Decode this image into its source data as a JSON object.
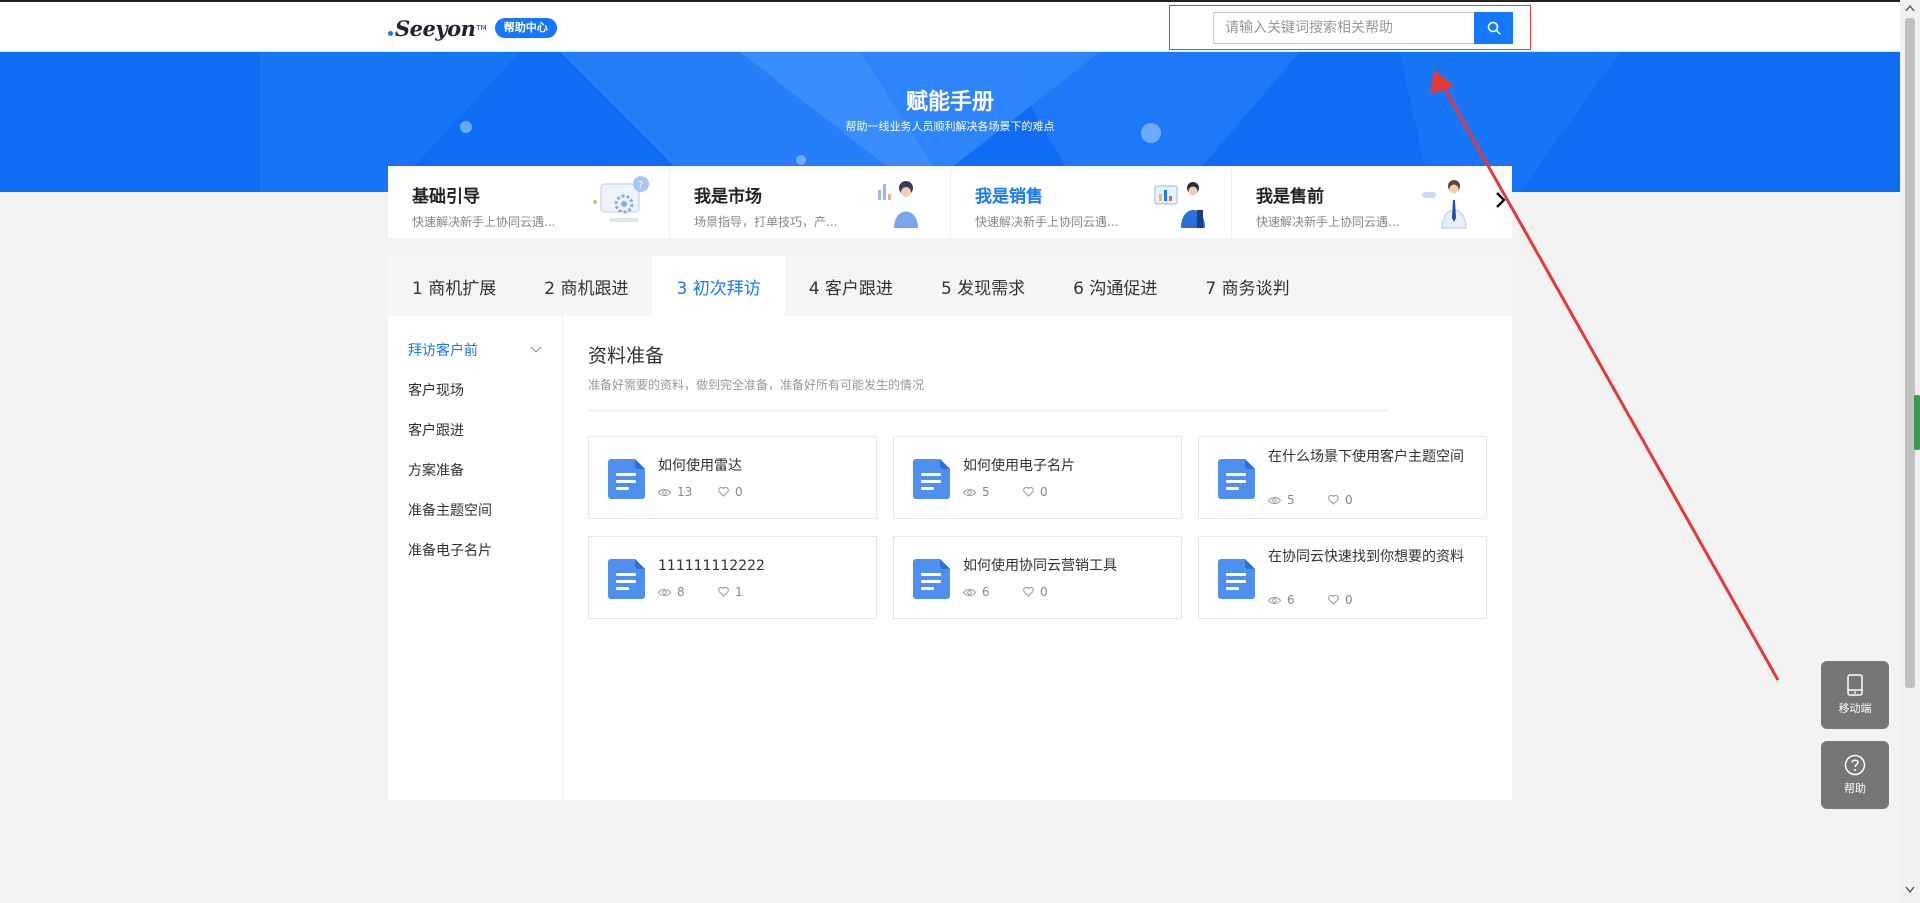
{
  "header": {
    "logo_text": "Seeyon",
    "logo_tm": "TM",
    "help_center_label": "帮助中心",
    "search": {
      "placeholder": "请输入关键词搜索相关帮助",
      "value": ""
    }
  },
  "banner": {
    "title": "赋能手册",
    "subtitle": "帮助一线业务人员顺利解决各场景下的难点"
  },
  "roles": [
    {
      "title": "基础引导",
      "desc": "快速解决新手上协同云遇...",
      "active": false
    },
    {
      "title": "我是市场",
      "desc": "场景指导，打单技巧，产...",
      "active": false
    },
    {
      "title": "我是销售",
      "desc": "快速解决新手上协同云遇...",
      "active": true
    },
    {
      "title": "我是售前",
      "desc": "快速解决新手上协同云遇...",
      "active": false
    }
  ],
  "tabs": [
    {
      "label": "1 商机扩展"
    },
    {
      "label": "2 商机跟进"
    },
    {
      "label": "3 初次拜访"
    },
    {
      "label": "4 客户跟进"
    },
    {
      "label": "5 发现需求"
    },
    {
      "label": "6 沟通促进"
    },
    {
      "label": "7 商务谈判"
    }
  ],
  "active_tab": "3 初次拜访",
  "sidebar": {
    "items": [
      {
        "label": "拜访客户前"
      },
      {
        "label": "客户现场"
      },
      {
        "label": "客户跟进"
      },
      {
        "label": "方案准备"
      },
      {
        "label": "准备主题空间"
      },
      {
        "label": "准备电子名片"
      }
    ],
    "active": "拜访客户前"
  },
  "section": {
    "title": "资料准备",
    "desc": "准备好需要的资料，做到完全准备，准备好所有可能发生的情况"
  },
  "articles": [
    {
      "title": "如何使用雷达",
      "views": "13",
      "likes": "0"
    },
    {
      "title": "如何使用电子名片",
      "views": "5",
      "likes": "0"
    },
    {
      "title": "在什么场景下使用客户主题空间",
      "views": "5",
      "likes": "0"
    },
    {
      "title": "111111112222",
      "views": "8",
      "likes": "1"
    },
    {
      "title": "如何使用协同云营销工具",
      "views": "6",
      "likes": "0"
    },
    {
      "title": "在协同云快速找到你想要的资料",
      "views": "6",
      "likes": "0"
    }
  ],
  "floating": {
    "mobile_label": "移动端",
    "help_label": "帮助"
  },
  "colors": {
    "primary": "#1677ff",
    "banner": "#0f6df5",
    "annotation": "#e53935",
    "float_bg": "#767676"
  },
  "icons": [
    "search-icon",
    "chevron-down-icon",
    "chevron-right-icon",
    "document-icon",
    "eye-icon",
    "heart-icon",
    "tablet-icon",
    "question-icon"
  ]
}
